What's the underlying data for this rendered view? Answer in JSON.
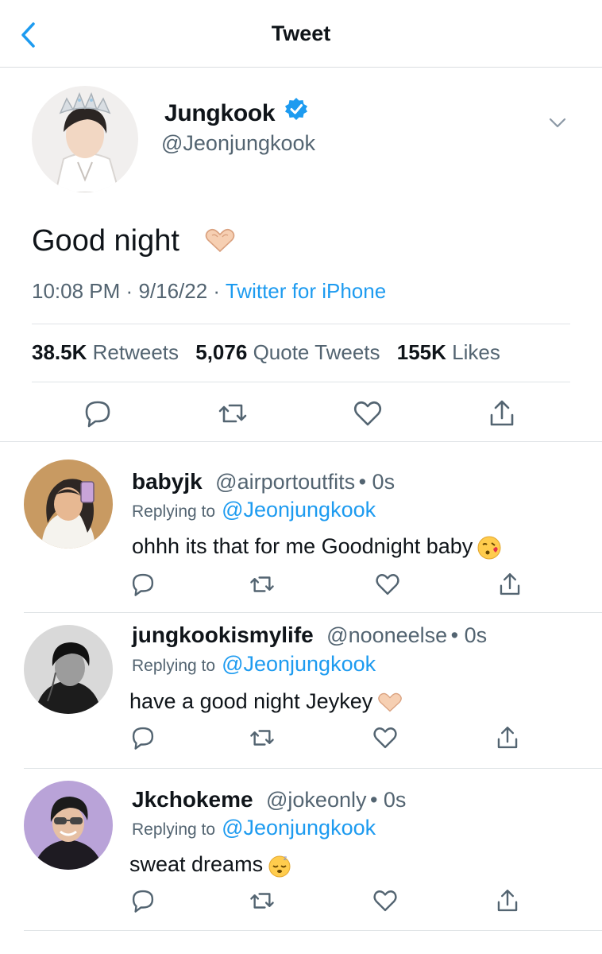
{
  "header": {
    "title": "Tweet",
    "back_icon": "chevron-left-icon"
  },
  "colors": {
    "accent": "#1d9bf0",
    "secondary_text": "#536471",
    "divider": "#dfe3e6",
    "verified": "#1d9bf0"
  },
  "tweet": {
    "author_name": "Jungkook",
    "author_handle": "@Jeonjungkook",
    "verified_icon": "verified-badge-icon",
    "more_icon": "chevron-down-icon",
    "text": "Good night",
    "emoji": "heart-hands-icon",
    "time": "10:08 PM",
    "separator": "·",
    "date": "9/16/22",
    "source": "Twitter for iPhone",
    "stats": {
      "retweets_count": "38.5K",
      "retweets_label": "Retweets",
      "quotes_count": "5,076",
      "quotes_label": "Quote Tweets",
      "likes_count": "155K",
      "likes_label": "Likes"
    },
    "actions": [
      "reply-icon",
      "retweet-icon",
      "like-icon",
      "share-icon"
    ]
  },
  "replies": [
    {
      "name": "babyjk",
      "handle": "@airportoutfits",
      "time": "• 0s",
      "replying_label": "Replying to",
      "replying_to": "@Jeonjungkook",
      "text": "ohhh its that for me Goodnight baby",
      "emoji": "face-blowing-kiss-icon"
    },
    {
      "name": "jungkookismylife",
      "handle": "@nooneelse",
      "time": "• 0s",
      "replying_label": "Replying to",
      "replying_to": "@Jeonjungkook",
      "text": "have a good night Jeykey",
      "emoji": "heart-hands-icon"
    },
    {
      "name": "Jkchokeme",
      "handle": "@jokeonly",
      "time": "• 0s",
      "replying_label": "Replying to",
      "replying_to": "@Jeonjungkook",
      "text": "sweat dreams",
      "emoji": "sleeping-face-icon"
    }
  ]
}
